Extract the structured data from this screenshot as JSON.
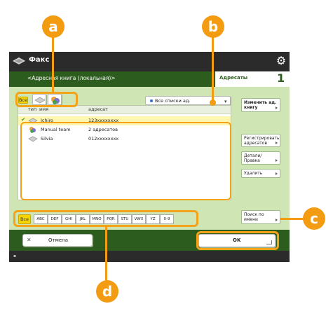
{
  "window": {
    "app_title": "Факс",
    "app_icon": "fax-icon",
    "settings_icon": "gear-icon"
  },
  "header": {
    "title": "<Адресная книга (локальная)>",
    "tab_label": "Адресаты",
    "tab_count": "1"
  },
  "filter": {
    "all_label": "Все",
    "type_icons": [
      "fax-type-icon",
      "group-type-icon"
    ],
    "list_select": "Все списки ад.",
    "register_button": "Изменить ад. книгу"
  },
  "list": {
    "columns": [
      "тип",
      "имя",
      "адресат"
    ],
    "rows": [
      {
        "selected": true,
        "icon": "fax-type-icon",
        "name": "Ichiro",
        "dest": "123xxxxxxxx"
      },
      {
        "selected": false,
        "icon": "group-type-icon",
        "name": "Manual team",
        "dest": "2 адресатов"
      },
      {
        "selected": false,
        "icon": "fax-type-icon",
        "name": "Silvia",
        "dest": "012xxxxxxxx"
      }
    ]
  },
  "side_buttons": {
    "register": "Регистрировать адресатов",
    "details": "Детали/ Правка",
    "delete": "Удалить",
    "search_by_name": "Поиск по имени"
  },
  "alphabet": {
    "all_label": "Все",
    "keys": [
      "ABC",
      "DEF",
      "GHI",
      "JKL",
      "MNO",
      "PQR",
      "STU",
      "VWX",
      "YZ",
      "0-9"
    ]
  },
  "actions": {
    "cancel": "Отмена",
    "ok": "OK"
  },
  "callouts": {
    "a": "a",
    "b": "b",
    "c": "c",
    "d": "d"
  },
  "colors": {
    "accent": "#f39c12",
    "title_bar": "#2b2b2b",
    "header_green": "#2c5d1e",
    "panel_green": "#cfe6b4",
    "selection_yellow": "#f5d400"
  }
}
